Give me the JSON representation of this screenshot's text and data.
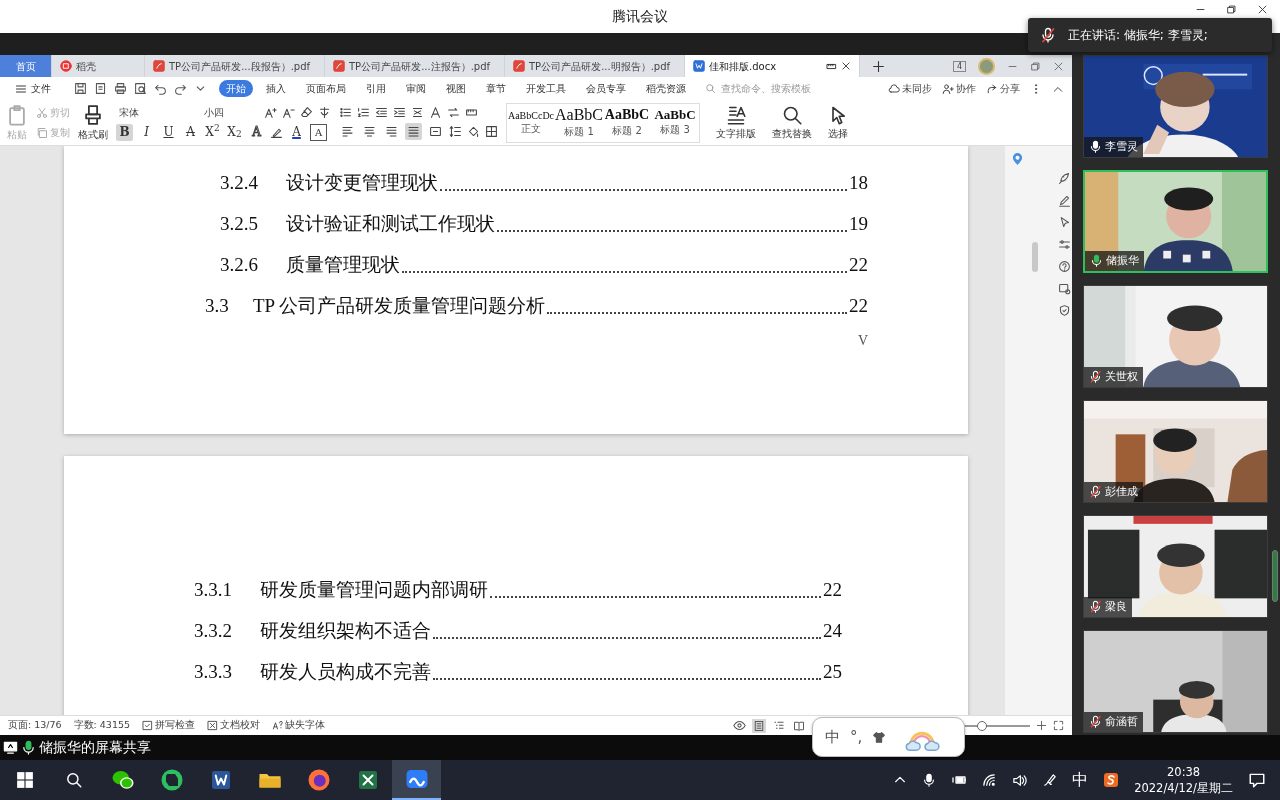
{
  "window": {
    "title": "腾讯会议"
  },
  "speaking_notice": {
    "text": "正在讲话: 储振华; 李雪灵;"
  },
  "wps": {
    "tabs": [
      {
        "label": "首页",
        "kind": "home",
        "selected": false
      },
      {
        "label": "稻壳",
        "kind": "daoke",
        "selected": false
      },
      {
        "label": "TP公司产品研发...段报告）.pdf",
        "kind": "pdf",
        "selected": false
      },
      {
        "label": "TP公司产品研发...注报告）.pdf",
        "kind": "pdf",
        "selected": false
      },
      {
        "label": "TP公司产品研发...明报告）.pdf",
        "kind": "pdf",
        "selected": false
      },
      {
        "label": "佳和排版.docx",
        "kind": "docx",
        "selected": true
      }
    ],
    "window_count": "4",
    "file_menu": "文件",
    "menu": [
      {
        "label": "开始",
        "selected": true
      },
      {
        "label": "插入",
        "selected": false
      },
      {
        "label": "页面布局",
        "selected": false
      },
      {
        "label": "引用",
        "selected": false
      },
      {
        "label": "审阅",
        "selected": false
      },
      {
        "label": "视图",
        "selected": false
      },
      {
        "label": "章节",
        "selected": false
      },
      {
        "label": "开发工具",
        "selected": false
      },
      {
        "label": "会员专享",
        "selected": false
      },
      {
        "label": "稻壳资源",
        "selected": false
      }
    ],
    "search": {
      "placeholder": "查找命令、搜索模板"
    },
    "actions": [
      {
        "label": "未同步",
        "kind": "sync"
      },
      {
        "label": "协作",
        "kind": "collab"
      },
      {
        "label": "分享",
        "kind": "share"
      }
    ],
    "ribbon": {
      "clipboard": [
        {
          "label": "粘贴",
          "kind": "paste",
          "disabled": true
        },
        {
          "label": "剪切",
          "kind": "cut",
          "disabled": true
        },
        {
          "label": "复制",
          "kind": "copy",
          "disabled": true
        },
        {
          "label": "格式刷",
          "kind": "brush",
          "disabled": false
        }
      ],
      "font": {
        "value": "宋体"
      },
      "size": {
        "value": "小四"
      },
      "format_buttons": [
        {
          "label": "B",
          "kind": "bold",
          "selected": true
        },
        {
          "label": "I",
          "kind": "italic",
          "selected": false
        },
        {
          "label": "U",
          "kind": "underline",
          "selected": false
        },
        {
          "label": "A",
          "kind": "strike",
          "selected": false
        },
        {
          "label": "X$^{2}$",
          "kind": "sup",
          "selected": false
        },
        {
          "label": "X$_{2}$",
          "kind": "sub",
          "selected": false
        },
        {
          "label": "A",
          "kind": "effect",
          "selected": false
        },
        {
          "label": "A",
          "kind": "color",
          "selected": false
        },
        {
          "label": "A",
          "kind": "border",
          "selected": false
        }
      ],
      "paragraph_buttons": [
        {
          "kind": "align-left",
          "selected": false
        },
        {
          "kind": "align-center",
          "selected": false
        },
        {
          "kind": "align-right",
          "selected": false
        },
        {
          "kind": "justify",
          "selected": true
        },
        {
          "kind": "distribute",
          "selected": false
        }
      ],
      "styles": [
        {
          "sample": "AaBbCcDc",
          "label": "正文",
          "kind": "body"
        },
        {
          "sample": "AaBbC",
          "label": "标题 1",
          "kind": "h1"
        },
        {
          "sample": "AaBbC",
          "label": "标题 2",
          "kind": "h2"
        },
        {
          "sample": "AaBbC",
          "label": "标题 3",
          "kind": "h3"
        }
      ],
      "tools": [
        {
          "label": "文字排版",
          "kind": "layout"
        },
        {
          "label": "查找替换",
          "kind": "find"
        },
        {
          "label": "选择",
          "kind": "select"
        }
      ]
    },
    "document": {
      "pages": [
        {
          "entries": [
            {
              "number": "3.2.4",
              "title": "设计变更管理现状",
              "page": "18",
              "kind": "subsection"
            },
            {
              "number": "3.2.5",
              "title": "设计验证和测试工作现状",
              "page": "19",
              "kind": "subsection"
            },
            {
              "number": "3.2.6",
              "title": "质量管理现状",
              "page": "22",
              "kind": "subsection"
            },
            {
              "number": "3.3",
              "title": "TP 公司产品研发质量管理问题分析",
              "page": "22",
              "kind": "section"
            }
          ],
          "page_number": "V"
        },
        {
          "entries": [
            {
              "number": "3.3.1",
              "title": "研发质量管理问题内部调研",
              "page": "22",
              "kind": "subsection"
            },
            {
              "number": "3.3.2",
              "title": "研发组织架构不适合",
              "page": "24",
              "kind": "subsection"
            },
            {
              "number": "3.3.3",
              "title": "研发人员构成不完善",
              "page": "25",
              "kind": "subsection"
            }
          ]
        }
      ]
    },
    "status_bar": {
      "items": [
        {
          "label": "页面: 13/76",
          "kind": "plain"
        },
        {
          "label": "字数: 43155",
          "kind": "plain"
        },
        {
          "label": "拼写检查",
          "kind": "spell"
        },
        {
          "label": "文档校对",
          "kind": "proof"
        },
        {
          "label": "缺失字体",
          "kind": "font"
        }
      ],
      "views": [
        {
          "kind": "page",
          "selected": true
        },
        {
          "kind": "outline",
          "selected": false
        },
        {
          "kind": "read",
          "selected": false
        }
      ],
      "zoom": {
        "level": 0.76
      }
    }
  },
  "ime_bar": {
    "mode": "中",
    "punct": "°,"
  },
  "screen_share": {
    "label": "储振华的屏幕共享"
  },
  "participants": [
    {
      "name": "李雪灵",
      "muted": false,
      "speaking": false
    },
    {
      "name": "储振华",
      "muted": false,
      "speaking": true
    },
    {
      "name": "关世权",
      "muted": true,
      "speaking": false
    },
    {
      "name": "彭佳成",
      "muted": true,
      "speaking": false
    },
    {
      "name": "梁良",
      "muted": true,
      "speaking": false
    },
    {
      "name": "俞涵哲",
      "muted": true,
      "speaking": false
    }
  ],
  "taskbar": {
    "apps": [
      {
        "kind": "wechat",
        "selected": false
      },
      {
        "kind": "evernote",
        "selected": false
      },
      {
        "kind": "word",
        "selected": false
      },
      {
        "kind": "explorer",
        "selected": false
      },
      {
        "kind": "firefox",
        "selected": false
      },
      {
        "kind": "excel",
        "selected": false
      },
      {
        "kind": "meeting",
        "selected": true
      }
    ],
    "ime": "中",
    "time": "20:38",
    "date": "2022/4/12/星期二"
  }
}
